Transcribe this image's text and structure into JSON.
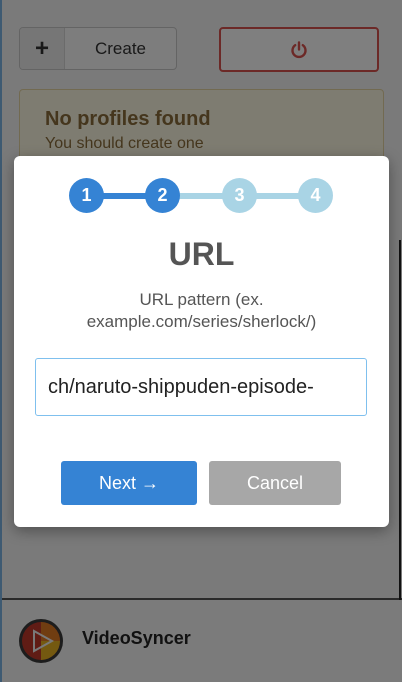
{
  "toolbar": {
    "create_label": "Create",
    "plus_symbol": "+",
    "power_icon": "power-icon",
    "power_color": "#d9534f"
  },
  "alert": {
    "title": "No profiles found",
    "subtitle": "You should create one"
  },
  "wizard": {
    "steps": [
      {
        "label": "1",
        "state": "done"
      },
      {
        "label": "2",
        "state": "active"
      },
      {
        "label": "3",
        "state": "pending"
      },
      {
        "label": "4",
        "state": "pending"
      }
    ],
    "title": "URL",
    "description": "URL pattern (ex. example.com/series/sherlock/)",
    "input_value": "ch/naruto-shippuden-episode-",
    "next_label": "Next →",
    "cancel_label": "Cancel",
    "colors": {
      "step_active": "#3583d4",
      "step_pending": "#a9d4e5",
      "next_bg": "#3583d4",
      "cancel_bg": "#a7a7a7"
    }
  },
  "footer": {
    "brand": "VideoSyncer",
    "logo_icon": "videosyncer-logo-icon"
  }
}
